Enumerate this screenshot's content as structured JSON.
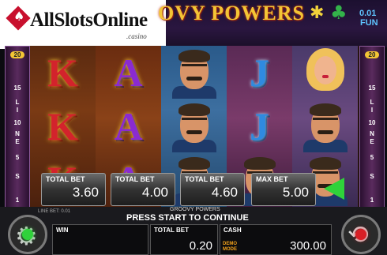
{
  "brand": {
    "name": "AllSlotsOnline",
    "sub": ".casino"
  },
  "title": {
    "text": "OVY POWERS"
  },
  "fun": {
    "amount": "0.01",
    "label": "FUN"
  },
  "lines_panel": {
    "top": "20",
    "numbers": [
      "15",
      "10",
      "5",
      "1"
    ],
    "word": [
      "L",
      "I",
      "N",
      "E",
      "S"
    ]
  },
  "reels": [
    [
      "K",
      "K",
      "K"
    ],
    [
      "A",
      "A",
      "A"
    ],
    [
      "man",
      "man",
      "man"
    ],
    [
      "J",
      "J",
      "man"
    ],
    [
      "woman",
      "man",
      "man"
    ]
  ],
  "bets": [
    {
      "label": "TOTAL BET",
      "value": "3.60"
    },
    {
      "label": "TOTAL BET",
      "value": "4.00"
    },
    {
      "label": "TOTAL BET",
      "value": "4.60"
    },
    {
      "label": "MAX BET",
      "value": "5.00"
    }
  ],
  "bottom": {
    "line_bet": "LINE BET: 0.01",
    "game_name": "GROOVY POWERS",
    "prompt": "PRESS START TO CONTINUE",
    "win_label": "WIN",
    "win_value": "",
    "total_bet_label": "TOTAL BET",
    "total_bet_value": "0.20",
    "cash_label": "CASH",
    "cash_value": "300.00",
    "demo_line1": "DEMO",
    "demo_line2": "MODE"
  },
  "colors": {
    "accent": "#2fd23a",
    "gold": "#f3c535",
    "stop": "#d81f26"
  }
}
